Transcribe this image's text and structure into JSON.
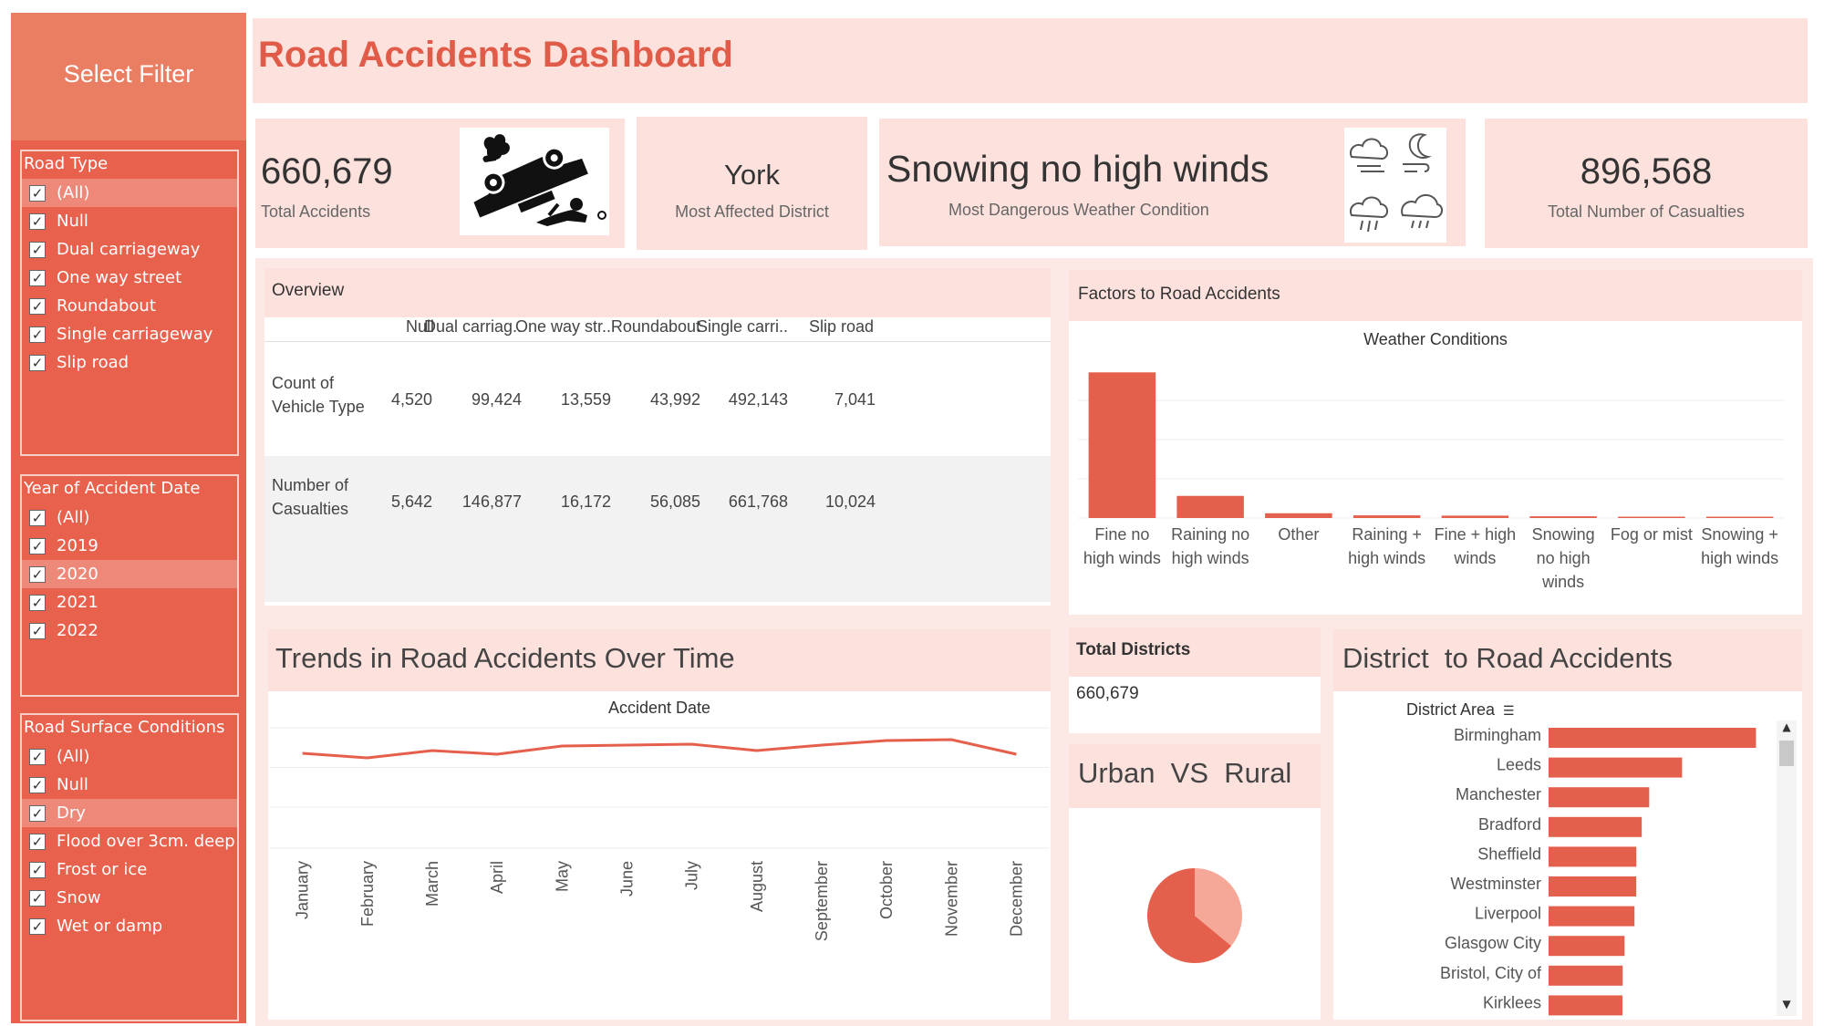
{
  "sidebar": {
    "title": "Select Filter",
    "filters": [
      {
        "header": "Road Type",
        "items": [
          {
            "label": "(All)",
            "checked": true,
            "highlighted": true
          },
          {
            "label": "Null",
            "checked": true
          },
          {
            "label": "Dual carriageway",
            "checked": true
          },
          {
            "label": "One way street",
            "checked": true
          },
          {
            "label": "Roundabout",
            "checked": true
          },
          {
            "label": "Single carriageway",
            "checked": true
          },
          {
            "label": "Slip road",
            "checked": true
          }
        ]
      },
      {
        "header": "Year of Accident Date",
        "items": [
          {
            "label": "(All)",
            "checked": true
          },
          {
            "label": "2019",
            "checked": true
          },
          {
            "label": "2020",
            "checked": true,
            "highlighted": true
          },
          {
            "label": "2021",
            "checked": true
          },
          {
            "label": "2022",
            "checked": true
          }
        ]
      },
      {
        "header": "Road Surface Conditions",
        "items": [
          {
            "label": "(All)",
            "checked": true
          },
          {
            "label": "Null",
            "checked": true
          },
          {
            "label": "Dry",
            "checked": true,
            "highlighted": true
          },
          {
            "label": "Flood over 3cm. deep",
            "checked": true
          },
          {
            "label": "Frost or ice",
            "checked": true
          },
          {
            "label": "Snow",
            "checked": true
          },
          {
            "label": "Wet or damp",
            "checked": true
          }
        ]
      }
    ]
  },
  "header": {
    "title": "Road Accidents Dashboard"
  },
  "kpis": {
    "total_accidents": {
      "value": "660,679",
      "label": "Total Accidents",
      "icon": "overturned-car-icon"
    },
    "district": {
      "value": "York",
      "label": "Most Affected District"
    },
    "weather": {
      "value": "Snowing no high winds",
      "label": "Most Dangerous Weather Condition",
      "icon": "weather-icons"
    },
    "casualties": {
      "value": "896,568",
      "label": "Total Number of Casualties"
    }
  },
  "overview": {
    "title": "Overview",
    "columns": [
      "Null",
      "Dual carriag..",
      "One way str..",
      "Roundabout",
      "Single carri..",
      "Slip road"
    ],
    "rows": [
      {
        "label_line1": "Count of",
        "label_line2": "Vehicle Type",
        "values": [
          "4,520",
          "99,424",
          "13,559",
          "43,992",
          "492,143",
          "7,041"
        ]
      },
      {
        "label_line1": "Number of",
        "label_line2": "Casualties",
        "values": [
          "5,642",
          "146,877",
          "16,172",
          "56,085",
          "661,768",
          "10,024"
        ]
      }
    ]
  },
  "factors": {
    "title": "Factors to Road Accidents",
    "chart_title": "Weather Conditions"
  },
  "trends": {
    "title": "Trends in Road Accidents Over Time",
    "chart_title": "Accident Date"
  },
  "total_districts": {
    "title": "Total Districts",
    "value": "660,679"
  },
  "urban_rural": {
    "title": "Urban  VS  Rural"
  },
  "district_panel": {
    "title": "District  to Road Accidents",
    "header": "District Area"
  },
  "colors": {
    "accent": "#e8614d",
    "bar": "#e5604c",
    "panel": "#fde1dd",
    "pie_light": "#f5a898"
  },
  "chart_data": [
    {
      "type": "bar",
      "title": "Weather Conditions",
      "categories": [
        "Fine no high winds",
        "Raining no high winds",
        "Other",
        "Raining + high winds",
        "Fine + high winds",
        "Snowing no high winds",
        "Fog or mist",
        "Snowing + high winds"
      ],
      "category_lines": [
        [
          "Fine no",
          "high winds"
        ],
        [
          "Raining no",
          "high winds"
        ],
        [
          "Other"
        ],
        [
          "Raining +",
          "high winds"
        ],
        [
          "Fine + high",
          "winds"
        ],
        [
          "Snowing",
          "no high",
          "winds"
        ],
        [
          "Fog or mist"
        ],
        [
          "Snowing +",
          "high winds"
        ]
      ],
      "values": [
        520000,
        79000,
        17000,
        9500,
        8500,
        6200,
        3500,
        600
      ],
      "ylim": [
        0,
        560000
      ],
      "grid": true
    },
    {
      "type": "line",
      "title": "Accident Date",
      "categories": [
        "January",
        "February",
        "March",
        "April",
        "May",
        "June",
        "July",
        "August",
        "September",
        "October",
        "November",
        "December"
      ],
      "values": [
        52000,
        49500,
        53500,
        51500,
        56000,
        56500,
        57000,
        53500,
        56500,
        59000,
        59500,
        51500
      ],
      "ylim": [
        0,
        70000
      ],
      "grid": true
    },
    {
      "type": "pie",
      "title": "",
      "categories": [
        "Urban",
        "Rural"
      ],
      "values": [
        64,
        36
      ]
    },
    {
      "type": "bar",
      "orientation": "horizontal",
      "title": "District Area",
      "categories": [
        "Birmingham",
        "Leeds",
        "Manchester",
        "Bradford",
        "Sheffield",
        "Westminster",
        "Liverpool",
        "Glasgow City",
        "Bristol, City of",
        "Kirklees"
      ],
      "values": [
        13491,
        8683,
        6546,
        6060,
        5710,
        5706,
        5587,
        4942,
        4819,
        4805
      ],
      "xlim": [
        0,
        14000
      ]
    }
  ]
}
